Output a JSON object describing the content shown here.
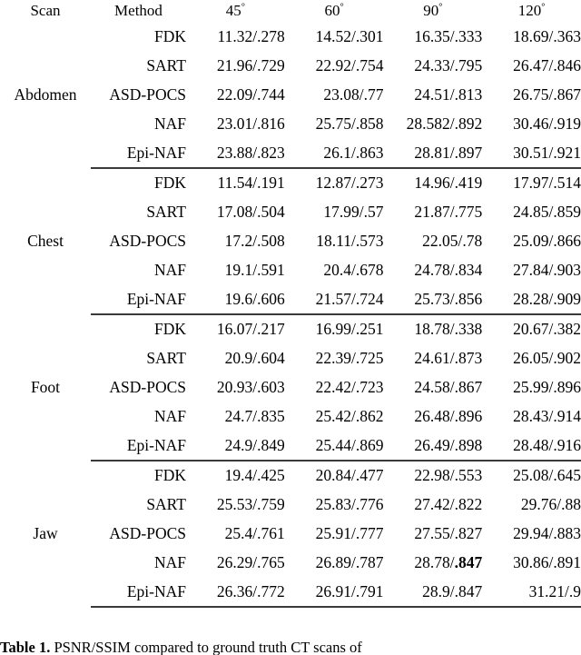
{
  "table": {
    "columns": {
      "scan": "Scan",
      "method": "Method",
      "angles": [
        "45",
        "60",
        "90",
        "120"
      ],
      "angle_unit": "°",
      "angle_labels": [
        "45°",
        "60°",
        "90°",
        "120°"
      ]
    },
    "metric_format": "PSNR/SSIM",
    "best_row_method": "Epi-NAF",
    "rule_color": "#3a3a3a",
    "groups": [
      {
        "scan": "Abdomen",
        "rows": [
          {
            "method": "FDK",
            "best": false,
            "values": [
              "11.32/.278",
              "14.52/.301",
              "16.35/.333",
              "18.69/.363"
            ]
          },
          {
            "method": "SART",
            "best": false,
            "values": [
              "21.96/.729",
              "22.92/.754",
              "24.33/.795",
              "26.47/.846"
            ]
          },
          {
            "method": "ASD-POCS",
            "best": false,
            "values": [
              "22.09/.744",
              "23.08/.77",
              "24.51/.813",
              "26.75/.867"
            ]
          },
          {
            "method": "NAF",
            "best": false,
            "values": [
              "23.01/.816",
              "25.75/.858",
              "28.582/.892",
              "30.46/.919"
            ]
          },
          {
            "method": "Epi-NAF",
            "best": true,
            "values": [
              "23.88/.823",
              "26.1/.863",
              "28.81/.897",
              "30.51/.921"
            ]
          }
        ]
      },
      {
        "scan": "Chest",
        "rows": [
          {
            "method": "FDK",
            "best": false,
            "values": [
              "11.54/.191",
              "12.87/.273",
              "14.96/.419",
              "17.97/.514"
            ]
          },
          {
            "method": "SART",
            "best": false,
            "values": [
              "17.08/.504",
              "17.99/.57",
              "21.87/.775",
              "24.85/.859"
            ]
          },
          {
            "method": "ASD-POCS",
            "best": false,
            "values": [
              "17.2/.508",
              "18.11/.573",
              "22.05/.78",
              "25.09/.866"
            ]
          },
          {
            "method": "NAF",
            "best": false,
            "values": [
              "19.1/.591",
              "20.4/.678",
              "24.78/.834",
              "27.84/.903"
            ]
          },
          {
            "method": "Epi-NAF",
            "best": true,
            "values": [
              "19.6/.606",
              "21.57/.724",
              "25.73/.856",
              "28.28/.909"
            ]
          }
        ]
      },
      {
        "scan": "Foot",
        "rows": [
          {
            "method": "FDK",
            "best": false,
            "values": [
              "16.07/.217",
              "16.99/.251",
              "18.78/.338",
              "20.67/.382"
            ]
          },
          {
            "method": "SART",
            "best": false,
            "values": [
              "20.9/.604",
              "22.39/.725",
              "24.61/.873",
              "26.05/.902"
            ]
          },
          {
            "method": "ASD-POCS",
            "best": false,
            "values": [
              "20.93/.603",
              "22.42/.723",
              "24.58/.867",
              "25.99/.896"
            ]
          },
          {
            "method": "NAF",
            "best": false,
            "values": [
              "24.7/.835",
              "25.42/.862",
              "26.48/.896",
              "28.43/.914"
            ]
          },
          {
            "method": "Epi-NAF",
            "best": true,
            "values": [
              "24.9/.849",
              "25.44/.869",
              "26.49/.898",
              "28.48/.916"
            ]
          }
        ]
      },
      {
        "scan": "Jaw",
        "rows": [
          {
            "method": "FDK",
            "best": false,
            "values": [
              "19.4/.425",
              "20.84/.477",
              "22.98/.553",
              "25.08/.645"
            ]
          },
          {
            "method": "SART",
            "best": false,
            "values": [
              "25.53/.759",
              "25.83/.776",
              "27.42/.822",
              "29.76/.88"
            ]
          },
          {
            "method": "ASD-POCS",
            "best": false,
            "values": [
              "25.4/.761",
              "25.91/.777",
              "27.55/.827",
              "29.94/.883"
            ]
          },
          {
            "method": "NAF",
            "best": false,
            "values": [
              "26.29/.765",
              "26.89/.787",
              "28.78/|.847|",
              "30.86/.891"
            ]
          },
          {
            "method": "Epi-NAF",
            "best": true,
            "values": [
              "26.36/.772",
              "26.91/.791",
              "28.9/.847",
              "31.21/.9"
            ]
          }
        ]
      }
    ]
  },
  "caption": {
    "label": "Table 1",
    "label_separator": ".",
    "text": "PSNR/SSIM compared to ground truth CT scans of"
  }
}
